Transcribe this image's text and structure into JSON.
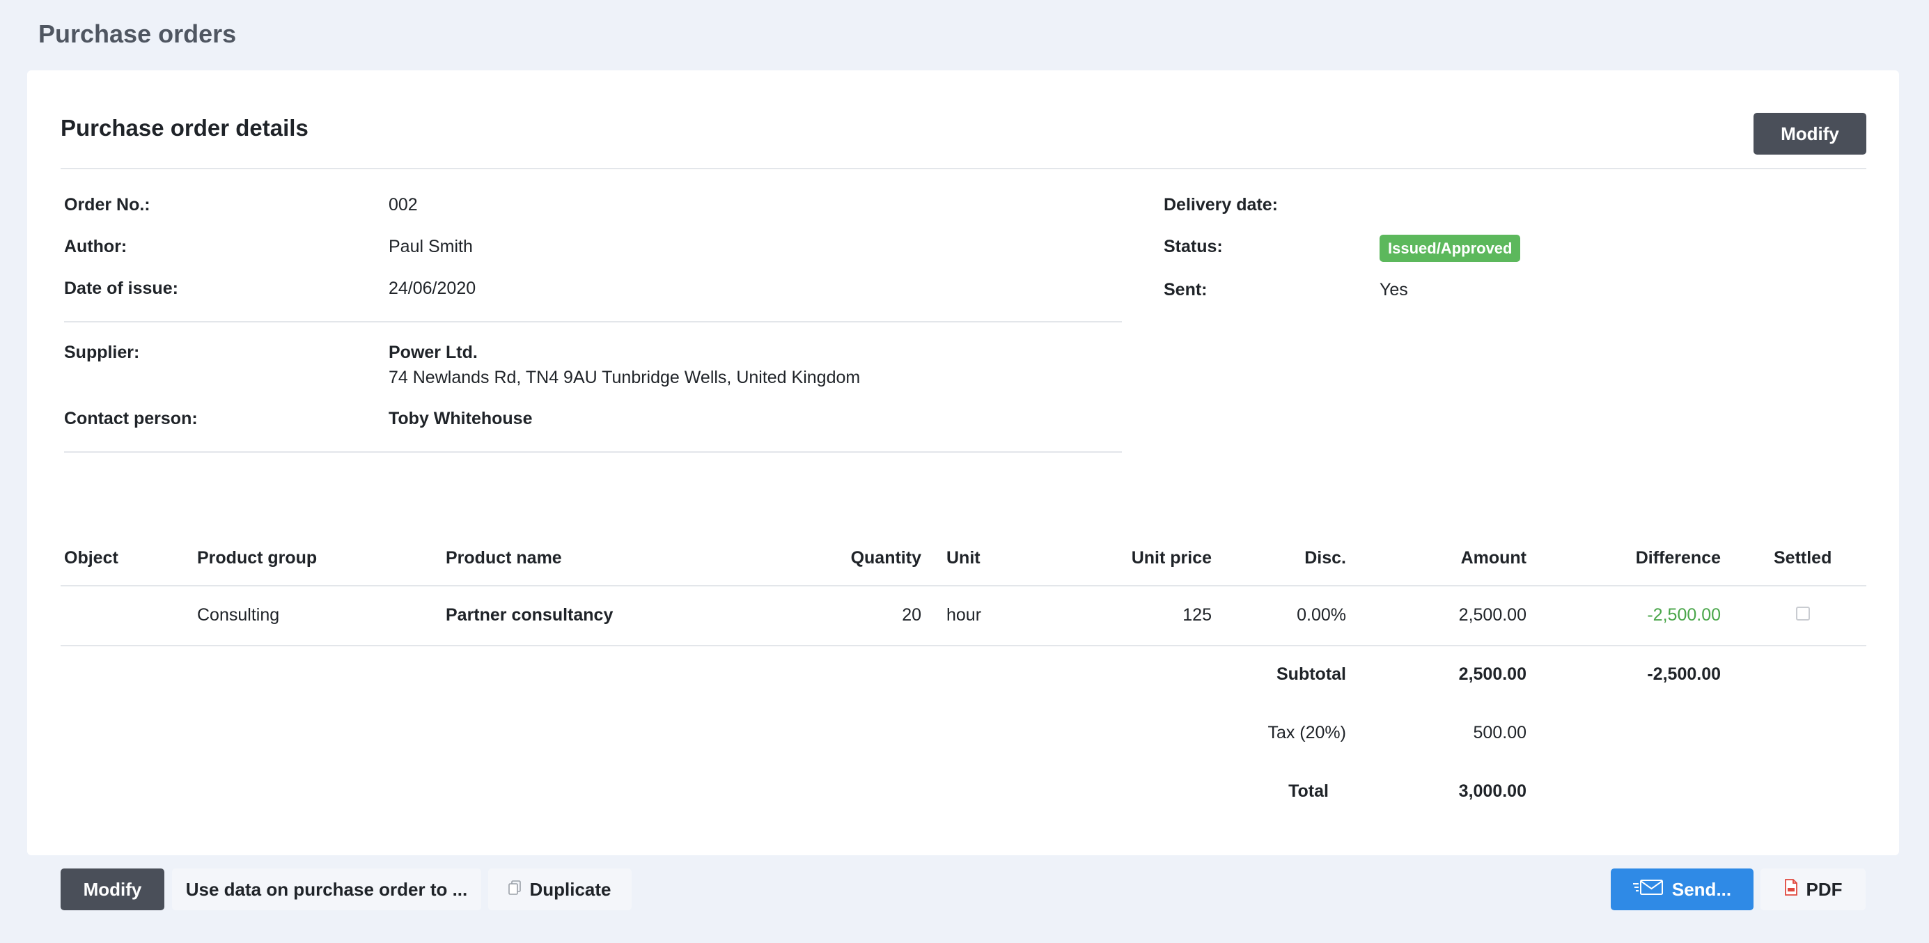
{
  "page": {
    "title": "Purchase orders"
  },
  "card": {
    "title": "Purchase order details",
    "modify_label": "Modify"
  },
  "details": {
    "order_no_label": "Order No.:",
    "order_no": "002",
    "author_label": "Author:",
    "author": "Paul Smith",
    "date_label": "Date of issue:",
    "date": "24/06/2020",
    "supplier_label": "Supplier:",
    "supplier_name": "Power Ltd.",
    "supplier_address": "74 Newlands Rd, TN4 9AU Tunbridge Wells, United Kingdom",
    "contact_label": "Contact person:",
    "contact": "Toby Whitehouse",
    "delivery_label": "Delivery date:",
    "delivery": "",
    "status_label": "Status:",
    "status": "Issued/Approved",
    "status_color": "#5cb85c",
    "sent_label": "Sent:",
    "sent": "Yes"
  },
  "table": {
    "headers": {
      "object": "Object",
      "group": "Product group",
      "name": "Product name",
      "quantity": "Quantity",
      "unit": "Unit",
      "unit_price": "Unit price",
      "disc": "Disc.",
      "amount": "Amount",
      "difference": "Difference",
      "settled": "Settled"
    },
    "rows": [
      {
        "object": "",
        "group": "Consulting",
        "name": "Partner consultancy",
        "quantity": "20",
        "unit": "hour",
        "unit_price": "125",
        "disc": "0.00%",
        "amount": "2,500.00",
        "difference": "-2,500.00",
        "settled": false
      }
    ],
    "subtotal_label": "Subtotal",
    "subtotal_amount": "2,500.00",
    "subtotal_difference": "-2,500.00",
    "tax_label": "Tax (20%)",
    "tax_amount": "500.00",
    "total_label": "Total",
    "total_amount": "3,000.00"
  },
  "footer": {
    "modify_label": "Modify",
    "use_data_label": "Use data on purchase order to ...",
    "duplicate_label": "Duplicate",
    "send_label": "Send...",
    "pdf_label": "PDF"
  },
  "colors": {
    "accent_blue": "#2f8ae6",
    "dark_button": "#4a4f59",
    "positive_green": "#4aa64a"
  },
  "icons": {
    "duplicate": "copy-icon",
    "send": "envelope-icon",
    "pdf": "pdf-file-icon"
  }
}
